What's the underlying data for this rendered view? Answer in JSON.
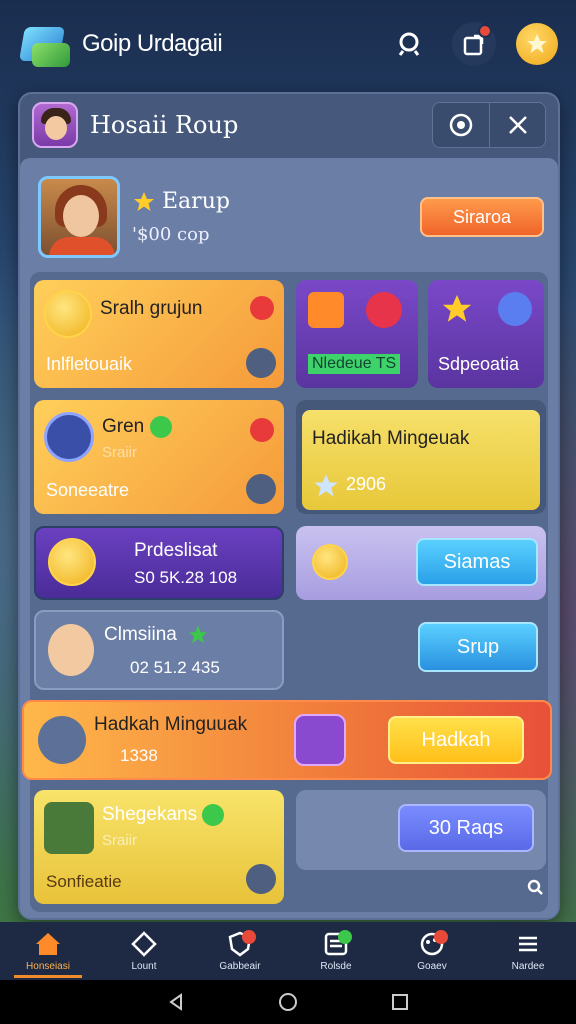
{
  "app": {
    "title": "Goip Urdagaii"
  },
  "topbar": {
    "icons": [
      "search-icon",
      "share-icon",
      "star-icon"
    ]
  },
  "panel": {
    "title": "Hosaii Roup",
    "buttons": [
      "camera-icon",
      "close-icon"
    ]
  },
  "profile": {
    "name": "Earup",
    "sub": "'$00 cop",
    "action_label": "Siraroa"
  },
  "cards": {
    "c1": {
      "title": "Sralh grujun",
      "sub": "Inlfletouaik"
    },
    "c2": {
      "tag": "Nledeue TS"
    },
    "c3": {
      "sub": "Sdpeoatia"
    },
    "c4": {
      "title": "Gren",
      "faded": "Sraiir",
      "sub": "Soneeatre"
    },
    "c5": {
      "title": "Hadikah Mingeuak",
      "value": "2906"
    },
    "c6": {
      "title": "Prdeslisat",
      "value": "S0 5K.28 108"
    },
    "c7": {
      "button": "Siamas"
    },
    "c8": {
      "title": "Clmsiina",
      "value": "02 51.2 435"
    },
    "c9": {
      "button": "Srup"
    },
    "c10": {
      "title": "Hadkah Minguuak",
      "value": "1338",
      "button": "Hadkah"
    },
    "c11": {
      "title": "Shegekans",
      "faded": "Sraiir",
      "sub": "Sonfieatie"
    },
    "c12": {
      "button": "30 Raqs"
    }
  },
  "bottom_nav": {
    "items": [
      {
        "label": "Honseiasi",
        "icon": "home-icon",
        "active": true
      },
      {
        "label": "Lount",
        "icon": "diamond-icon"
      },
      {
        "label": "Gabbeair",
        "icon": "shield-icon",
        "badge": "red"
      },
      {
        "label": "Rolsde",
        "icon": "list-icon",
        "badge": "green"
      },
      {
        "label": "Goaev",
        "icon": "palette-icon",
        "badge": "red"
      },
      {
        "label": "Nardee",
        "icon": "menu-icon"
      }
    ]
  },
  "system_nav": [
    "back-icon",
    "home-circle-icon",
    "recents-icon"
  ]
}
